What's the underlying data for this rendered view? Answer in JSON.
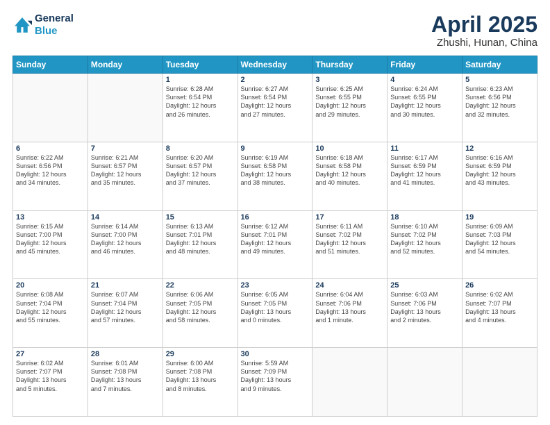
{
  "header": {
    "logo_line1": "General",
    "logo_line2": "Blue",
    "title": "April 2025",
    "subtitle": "Zhushi, Hunan, China"
  },
  "weekdays": [
    "Sunday",
    "Monday",
    "Tuesday",
    "Wednesday",
    "Thursday",
    "Friday",
    "Saturday"
  ],
  "weeks": [
    [
      {
        "day": "",
        "info": ""
      },
      {
        "day": "",
        "info": ""
      },
      {
        "day": "1",
        "info": "Sunrise: 6:28 AM\nSunset: 6:54 PM\nDaylight: 12 hours\nand 26 minutes."
      },
      {
        "day": "2",
        "info": "Sunrise: 6:27 AM\nSunset: 6:54 PM\nDaylight: 12 hours\nand 27 minutes."
      },
      {
        "day": "3",
        "info": "Sunrise: 6:25 AM\nSunset: 6:55 PM\nDaylight: 12 hours\nand 29 minutes."
      },
      {
        "day": "4",
        "info": "Sunrise: 6:24 AM\nSunset: 6:55 PM\nDaylight: 12 hours\nand 30 minutes."
      },
      {
        "day": "5",
        "info": "Sunrise: 6:23 AM\nSunset: 6:56 PM\nDaylight: 12 hours\nand 32 minutes."
      }
    ],
    [
      {
        "day": "6",
        "info": "Sunrise: 6:22 AM\nSunset: 6:56 PM\nDaylight: 12 hours\nand 34 minutes."
      },
      {
        "day": "7",
        "info": "Sunrise: 6:21 AM\nSunset: 6:57 PM\nDaylight: 12 hours\nand 35 minutes."
      },
      {
        "day": "8",
        "info": "Sunrise: 6:20 AM\nSunset: 6:57 PM\nDaylight: 12 hours\nand 37 minutes."
      },
      {
        "day": "9",
        "info": "Sunrise: 6:19 AM\nSunset: 6:58 PM\nDaylight: 12 hours\nand 38 minutes."
      },
      {
        "day": "10",
        "info": "Sunrise: 6:18 AM\nSunset: 6:58 PM\nDaylight: 12 hours\nand 40 minutes."
      },
      {
        "day": "11",
        "info": "Sunrise: 6:17 AM\nSunset: 6:59 PM\nDaylight: 12 hours\nand 41 minutes."
      },
      {
        "day": "12",
        "info": "Sunrise: 6:16 AM\nSunset: 6:59 PM\nDaylight: 12 hours\nand 43 minutes."
      }
    ],
    [
      {
        "day": "13",
        "info": "Sunrise: 6:15 AM\nSunset: 7:00 PM\nDaylight: 12 hours\nand 45 minutes."
      },
      {
        "day": "14",
        "info": "Sunrise: 6:14 AM\nSunset: 7:00 PM\nDaylight: 12 hours\nand 46 minutes."
      },
      {
        "day": "15",
        "info": "Sunrise: 6:13 AM\nSunset: 7:01 PM\nDaylight: 12 hours\nand 48 minutes."
      },
      {
        "day": "16",
        "info": "Sunrise: 6:12 AM\nSunset: 7:01 PM\nDaylight: 12 hours\nand 49 minutes."
      },
      {
        "day": "17",
        "info": "Sunrise: 6:11 AM\nSunset: 7:02 PM\nDaylight: 12 hours\nand 51 minutes."
      },
      {
        "day": "18",
        "info": "Sunrise: 6:10 AM\nSunset: 7:02 PM\nDaylight: 12 hours\nand 52 minutes."
      },
      {
        "day": "19",
        "info": "Sunrise: 6:09 AM\nSunset: 7:03 PM\nDaylight: 12 hours\nand 54 minutes."
      }
    ],
    [
      {
        "day": "20",
        "info": "Sunrise: 6:08 AM\nSunset: 7:04 PM\nDaylight: 12 hours\nand 55 minutes."
      },
      {
        "day": "21",
        "info": "Sunrise: 6:07 AM\nSunset: 7:04 PM\nDaylight: 12 hours\nand 57 minutes."
      },
      {
        "day": "22",
        "info": "Sunrise: 6:06 AM\nSunset: 7:05 PM\nDaylight: 12 hours\nand 58 minutes."
      },
      {
        "day": "23",
        "info": "Sunrise: 6:05 AM\nSunset: 7:05 PM\nDaylight: 13 hours\nand 0 minutes."
      },
      {
        "day": "24",
        "info": "Sunrise: 6:04 AM\nSunset: 7:06 PM\nDaylight: 13 hours\nand 1 minute."
      },
      {
        "day": "25",
        "info": "Sunrise: 6:03 AM\nSunset: 7:06 PM\nDaylight: 13 hours\nand 2 minutes."
      },
      {
        "day": "26",
        "info": "Sunrise: 6:02 AM\nSunset: 7:07 PM\nDaylight: 13 hours\nand 4 minutes."
      }
    ],
    [
      {
        "day": "27",
        "info": "Sunrise: 6:02 AM\nSunset: 7:07 PM\nDaylight: 13 hours\nand 5 minutes."
      },
      {
        "day": "28",
        "info": "Sunrise: 6:01 AM\nSunset: 7:08 PM\nDaylight: 13 hours\nand 7 minutes."
      },
      {
        "day": "29",
        "info": "Sunrise: 6:00 AM\nSunset: 7:08 PM\nDaylight: 13 hours\nand 8 minutes."
      },
      {
        "day": "30",
        "info": "Sunrise: 5:59 AM\nSunset: 7:09 PM\nDaylight: 13 hours\nand 9 minutes."
      },
      {
        "day": "",
        "info": ""
      },
      {
        "day": "",
        "info": ""
      },
      {
        "day": "",
        "info": ""
      }
    ]
  ]
}
